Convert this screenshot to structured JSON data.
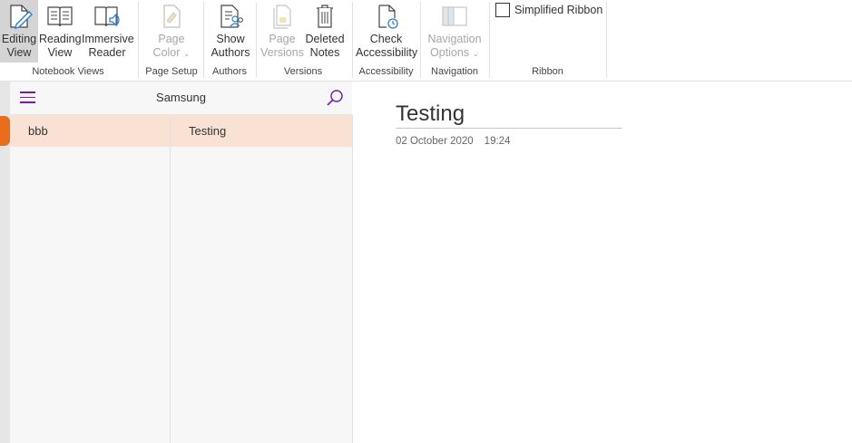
{
  "ribbon": {
    "groups": [
      {
        "label": "Notebook Views"
      },
      {
        "label": "Page Setup"
      },
      {
        "label": "Authors"
      },
      {
        "label": "Versions"
      },
      {
        "label": "Accessibility"
      },
      {
        "label": "Navigation"
      },
      {
        "label": "Ribbon"
      }
    ],
    "buttons": {
      "editing_view": {
        "line1": "Editing",
        "line2": "View"
      },
      "reading_view": {
        "line1": "Reading",
        "line2": "View"
      },
      "immersive_reader": {
        "line1": "Immersive",
        "line2": "Reader"
      },
      "page_color": {
        "line1": "Page",
        "line2": "Color"
      },
      "show_authors": {
        "line1": "Show",
        "line2": "Authors"
      },
      "page_versions": {
        "line1": "Page",
        "line2": "Versions"
      },
      "deleted_notes": {
        "line1": "Deleted",
        "line2": "Notes"
      },
      "check_accessibility": {
        "line1": "Check",
        "line2": "Accessibility"
      },
      "navigation_options": {
        "line1": "Navigation",
        "line2": "Options"
      }
    },
    "simplified_ribbon_label": "Simplified Ribbon",
    "accent_color": "#7719aa",
    "section_color": "#ea6c1d"
  },
  "nav": {
    "notebook_name": "Samsung",
    "sections": [
      {
        "label": "bbb"
      }
    ],
    "pages": [
      {
        "label": "Testing"
      }
    ]
  },
  "page": {
    "title": "Testing",
    "date": "02 October 2020",
    "time": "19:24"
  }
}
